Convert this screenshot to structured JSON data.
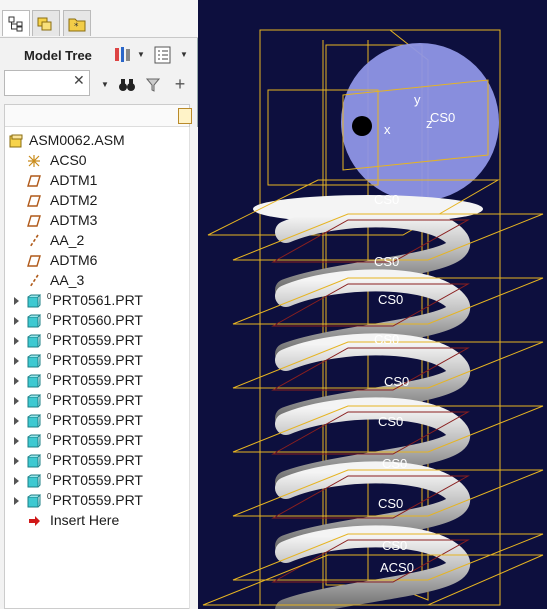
{
  "panel": {
    "tabs": [
      {
        "name": "model-tree-tab"
      },
      {
        "name": "layers-tab"
      },
      {
        "name": "favorites-tab"
      }
    ],
    "title": "Model Tree",
    "search": {
      "value": "",
      "placeholder": ""
    }
  },
  "tree": {
    "root": "ASM0062.ASM",
    "items": [
      {
        "label": "ACS0",
        "kind": "csys"
      },
      {
        "label": "ADTM1",
        "kind": "datum-plane"
      },
      {
        "label": "ADTM2",
        "kind": "datum-plane"
      },
      {
        "label": "ADTM3",
        "kind": "datum-plane"
      },
      {
        "label": "AA_2",
        "kind": "axis"
      },
      {
        "label": "ADTM6",
        "kind": "datum-plane"
      },
      {
        "label": "AA_3",
        "kind": "axis"
      },
      {
        "label": "PRT0561.PRT",
        "kind": "part",
        "superscript": "0"
      },
      {
        "label": "PRT0560.PRT",
        "kind": "part",
        "superscript": "0"
      },
      {
        "label": "PRT0559.PRT",
        "kind": "part",
        "superscript": "0"
      },
      {
        "label": "PRT0559.PRT",
        "kind": "part",
        "superscript": "0"
      },
      {
        "label": "PRT0559.PRT",
        "kind": "part",
        "superscript": "0"
      },
      {
        "label": "PRT0559.PRT",
        "kind": "part",
        "superscript": "0"
      },
      {
        "label": "PRT0559.PRT",
        "kind": "part",
        "superscript": "0"
      },
      {
        "label": "PRT0559.PRT",
        "kind": "part",
        "superscript": "0"
      },
      {
        "label": "PRT0559.PRT",
        "kind": "part",
        "superscript": "0"
      },
      {
        "label": "PRT0559.PRT",
        "kind": "part",
        "superscript": "0"
      },
      {
        "label": "PRT0559.PRT",
        "kind": "part",
        "superscript": "0"
      },
      {
        "label": "Insert Here",
        "kind": "insert"
      }
    ]
  },
  "viewport": {
    "background": "#0d0f3e",
    "datum_color": "#e6b422",
    "labels": {
      "top_csys": "CS0",
      "coil_csys": "CS0",
      "bottom_csys": "ACS0",
      "axis_x": "x",
      "axis_y": "y",
      "axis_z": "z"
    }
  }
}
